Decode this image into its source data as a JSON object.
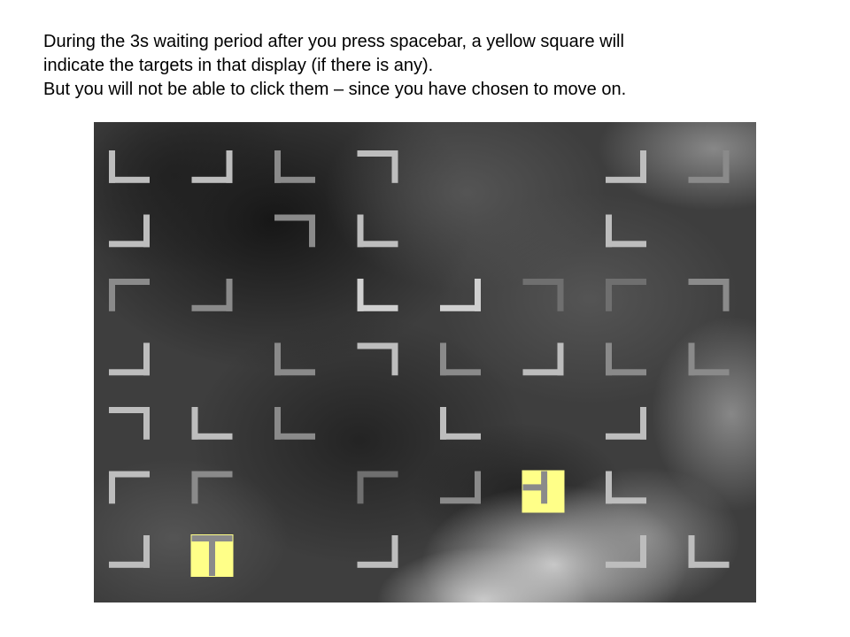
{
  "instructions": {
    "line1": "During the 3s waiting period after you press spacebar, a yellow square will",
    "line2": "indicate the targets in that display (if there is any).",
    "line3": "But you will not be able to click them – since you have chosen to move on."
  },
  "colors": {
    "highlight": "#ffff88",
    "background": "#3e3e3e"
  },
  "stimulus": {
    "grid_columns": 8,
    "grid_rows": 7,
    "items": [
      {
        "row": 0,
        "col": 0,
        "shape": "L",
        "shade": "#bdbdbd"
      },
      {
        "row": 0,
        "col": 1,
        "shape": "J",
        "shade": "#bdbdbd"
      },
      {
        "row": 0,
        "col": 2,
        "shape": "L",
        "shade": "#8a8a8a"
      },
      {
        "row": 0,
        "col": 3,
        "shape": "7",
        "shade": "#bdbdbd"
      },
      {
        "row": 0,
        "col": 6,
        "shape": "J",
        "shade": "#bdbdbd"
      },
      {
        "row": 0,
        "col": 7,
        "shape": "J",
        "shade": "#8a8a8a"
      },
      {
        "row": 1,
        "col": 0,
        "shape": "J",
        "shade": "#bdbdbd"
      },
      {
        "row": 1,
        "col": 2,
        "shape": "7",
        "shade": "#8a8a8a"
      },
      {
        "row": 1,
        "col": 3,
        "shape": "L",
        "shade": "#bdbdbd"
      },
      {
        "row": 1,
        "col": 6,
        "shape": "L",
        "shade": "#bdbdbd"
      },
      {
        "row": 2,
        "col": 0,
        "shape": "F",
        "shade": "#8a8a8a"
      },
      {
        "row": 2,
        "col": 1,
        "shape": "J",
        "shade": "#8a8a8a"
      },
      {
        "row": 2,
        "col": 3,
        "shape": "L",
        "shade": "#d0d0d0"
      },
      {
        "row": 2,
        "col": 4,
        "shape": "J",
        "shade": "#d0d0d0"
      },
      {
        "row": 2,
        "col": 5,
        "shape": "7",
        "shade": "#6f6f6f"
      },
      {
        "row": 2,
        "col": 6,
        "shape": "F",
        "shade": "#6f6f6f"
      },
      {
        "row": 2,
        "col": 7,
        "shape": "7",
        "shade": "#8a8a8a"
      },
      {
        "row": 3,
        "col": 0,
        "shape": "J",
        "shade": "#bdbdbd"
      },
      {
        "row": 3,
        "col": 2,
        "shape": "L",
        "shade": "#8a8a8a"
      },
      {
        "row": 3,
        "col": 3,
        "shape": "7",
        "shade": "#bdbdbd"
      },
      {
        "row": 3,
        "col": 4,
        "shape": "L",
        "shade": "#8a8a8a"
      },
      {
        "row": 3,
        "col": 5,
        "shape": "J",
        "shade": "#bdbdbd"
      },
      {
        "row": 3,
        "col": 6,
        "shape": "L",
        "shade": "#8a8a8a"
      },
      {
        "row": 3,
        "col": 7,
        "shape": "L",
        "shade": "#8a8a8a"
      },
      {
        "row": 4,
        "col": 0,
        "shape": "7",
        "shade": "#bdbdbd"
      },
      {
        "row": 4,
        "col": 1,
        "shape": "L",
        "shade": "#bdbdbd"
      },
      {
        "row": 4,
        "col": 2,
        "shape": "L",
        "shade": "#8a8a8a"
      },
      {
        "row": 4,
        "col": 4,
        "shape": "L",
        "shade": "#bdbdbd"
      },
      {
        "row": 4,
        "col": 6,
        "shape": "J",
        "shade": "#bdbdbd"
      },
      {
        "row": 5,
        "col": 0,
        "shape": "F",
        "shade": "#bdbdbd"
      },
      {
        "row": 5,
        "col": 1,
        "shape": "F",
        "shade": "#8a8a8a"
      },
      {
        "row": 5,
        "col": 3,
        "shape": "F",
        "shade": "#6f6f6f"
      },
      {
        "row": 5,
        "col": 4,
        "shape": "J",
        "shade": "#8a8a8a"
      },
      {
        "row": 5,
        "col": 5,
        "shape": "T-right",
        "shade": "#8a8a8a",
        "target": true
      },
      {
        "row": 5,
        "col": 6,
        "shape": "L",
        "shade": "#bdbdbd"
      },
      {
        "row": 6,
        "col": 0,
        "shape": "J",
        "shade": "#bdbdbd"
      },
      {
        "row": 6,
        "col": 1,
        "shape": "T-down",
        "shade": "#8a8a8a",
        "target": true
      },
      {
        "row": 6,
        "col": 3,
        "shape": "J",
        "shade": "#bdbdbd"
      },
      {
        "row": 6,
        "col": 6,
        "shape": "J",
        "shade": "#bdbdbd"
      },
      {
        "row": 6,
        "col": 7,
        "shape": "L",
        "shade": "#bdbdbd"
      }
    ]
  }
}
